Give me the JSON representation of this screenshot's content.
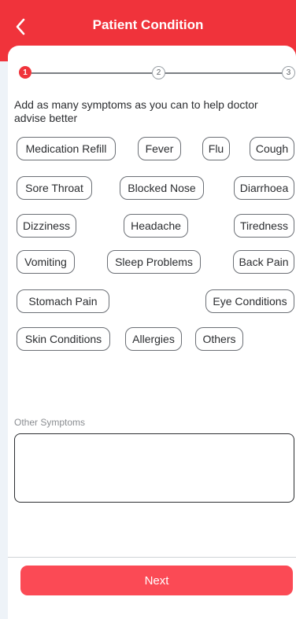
{
  "header": {
    "title": "Patient Condition",
    "back_icon": "chevron-left-icon",
    "background": "#f0333b"
  },
  "stepper": {
    "steps": [
      "1",
      "2",
      "3"
    ],
    "active_step": 1,
    "active_color": "#f0333b"
  },
  "instructions": "Add as many symptoms as you can to help doctor advise better",
  "symptoms": [
    "Medication Refill",
    "Fever",
    "Flu",
    "Cough",
    "Sore Throat",
    "Blocked Nose",
    "Diarrhoea",
    "Dizziness",
    "Headache",
    "Tiredness",
    "Vomiting",
    "Sleep Problems",
    "Back Pain",
    "Stomach Pain",
    "Eye Conditions",
    "Skin Conditions",
    "Allergies",
    "Others"
  ],
  "other_symptoms": {
    "label": "Other Symptoms",
    "value": ""
  },
  "footer": {
    "next_label": "Next",
    "button_color": "#fb4a55"
  }
}
